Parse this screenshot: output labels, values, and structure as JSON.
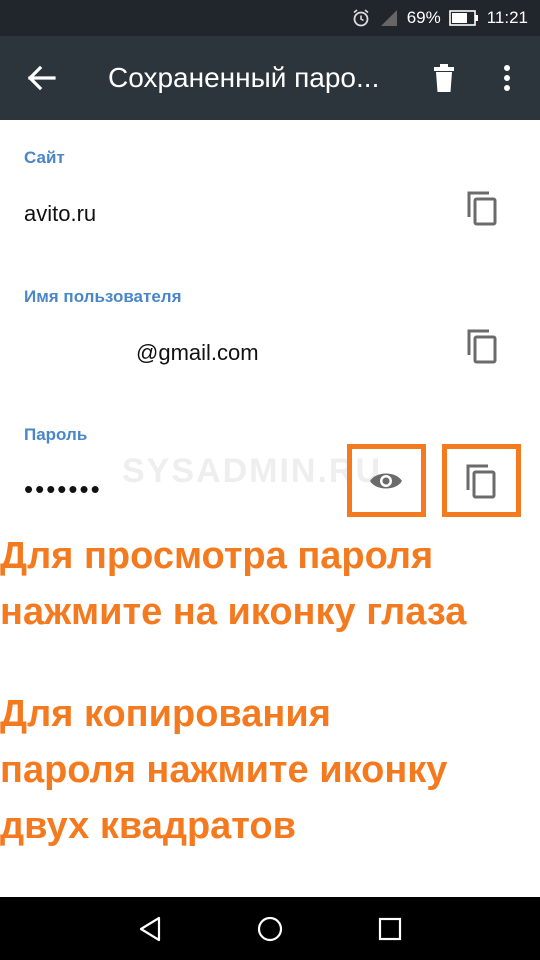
{
  "status_bar": {
    "battery_percent": "69%",
    "time": "11:21",
    "icons": [
      "alarm-icon",
      "signal-icon",
      "battery-icon"
    ]
  },
  "toolbar": {
    "title": "Сохраненный паро...",
    "icons": [
      "back-arrow-icon",
      "delete-icon",
      "more-vert-icon"
    ]
  },
  "fields": {
    "site": {
      "label": "Сайт",
      "value": "avito.ru"
    },
    "username": {
      "label": "Имя пользователя",
      "value": "@gmail.com"
    },
    "password": {
      "label": "Пароль",
      "value": "•••••••"
    }
  },
  "watermark": "SYSADMIN.RU",
  "instructions": {
    "view": "Для просмотра пароля\nнажмите на иконку глаза",
    "copy": "Для копирования\nпароля нажмите иконку\nдвух квадратов"
  },
  "colors": {
    "accent_label": "#4a86c8",
    "annotation": "#f47a20",
    "toolbar_bg": "#2c353b",
    "statusbar_bg": "#20262b"
  },
  "nav_bar": {
    "icons": [
      "back-triangle-icon",
      "home-circle-icon",
      "recents-square-icon"
    ]
  }
}
